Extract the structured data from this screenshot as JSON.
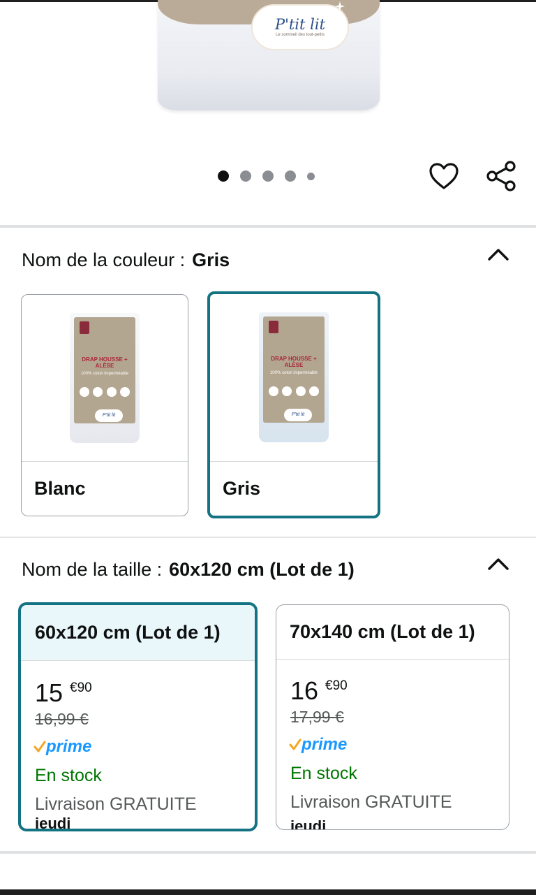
{
  "hero": {
    "brand_name": "P'tit lit",
    "brand_tagline": "Le sommeil des tout-petits",
    "carousel_total": 5,
    "carousel_active_index": 0
  },
  "actions": {
    "favorite_icon": "heart-icon",
    "share_icon": "share-icon"
  },
  "color_section": {
    "label": "Nom de la couleur :",
    "selected_value": "Gris",
    "options": [
      {
        "name": "Blanc",
        "selected": false,
        "pack_title": "DRAP HOUSSE + ALÈSE",
        "pack_sub": "100% coton imperméable",
        "pack_brand": "P'tit lit"
      },
      {
        "name": "Gris",
        "selected": true,
        "pack_title": "DRAP HOUSSE + ALÈSE",
        "pack_sub": "100% coton imperméable",
        "pack_brand": "P'tit lit"
      }
    ]
  },
  "size_section": {
    "label": "Nom de la taille :",
    "selected_value": "60x120 cm (Lot de 1)",
    "options": [
      {
        "name": "60x120 cm (Lot de 1)",
        "selected": true,
        "price_whole": "15",
        "price_fraction": "€90",
        "old_price": "16,99 €",
        "prime": "prime",
        "stock": "En stock",
        "delivery": "Livraison GRATUITE",
        "delivery_day": "jeudi"
      },
      {
        "name": "70x140 cm (Lot de 1)",
        "selected": false,
        "price_whole": "16",
        "price_fraction": "€90",
        "old_price": "17,99 €",
        "prime": "prime",
        "stock": "En stock",
        "delivery": "Livraison GRATUITE",
        "delivery_day": "jeudi"
      }
    ]
  },
  "colors": {
    "accent_teal": "#147383",
    "selected_bg": "#e9f7fb",
    "prime_blue": "#1a98ff",
    "prime_check": "#f5a623",
    "stock_green": "#007600"
  }
}
